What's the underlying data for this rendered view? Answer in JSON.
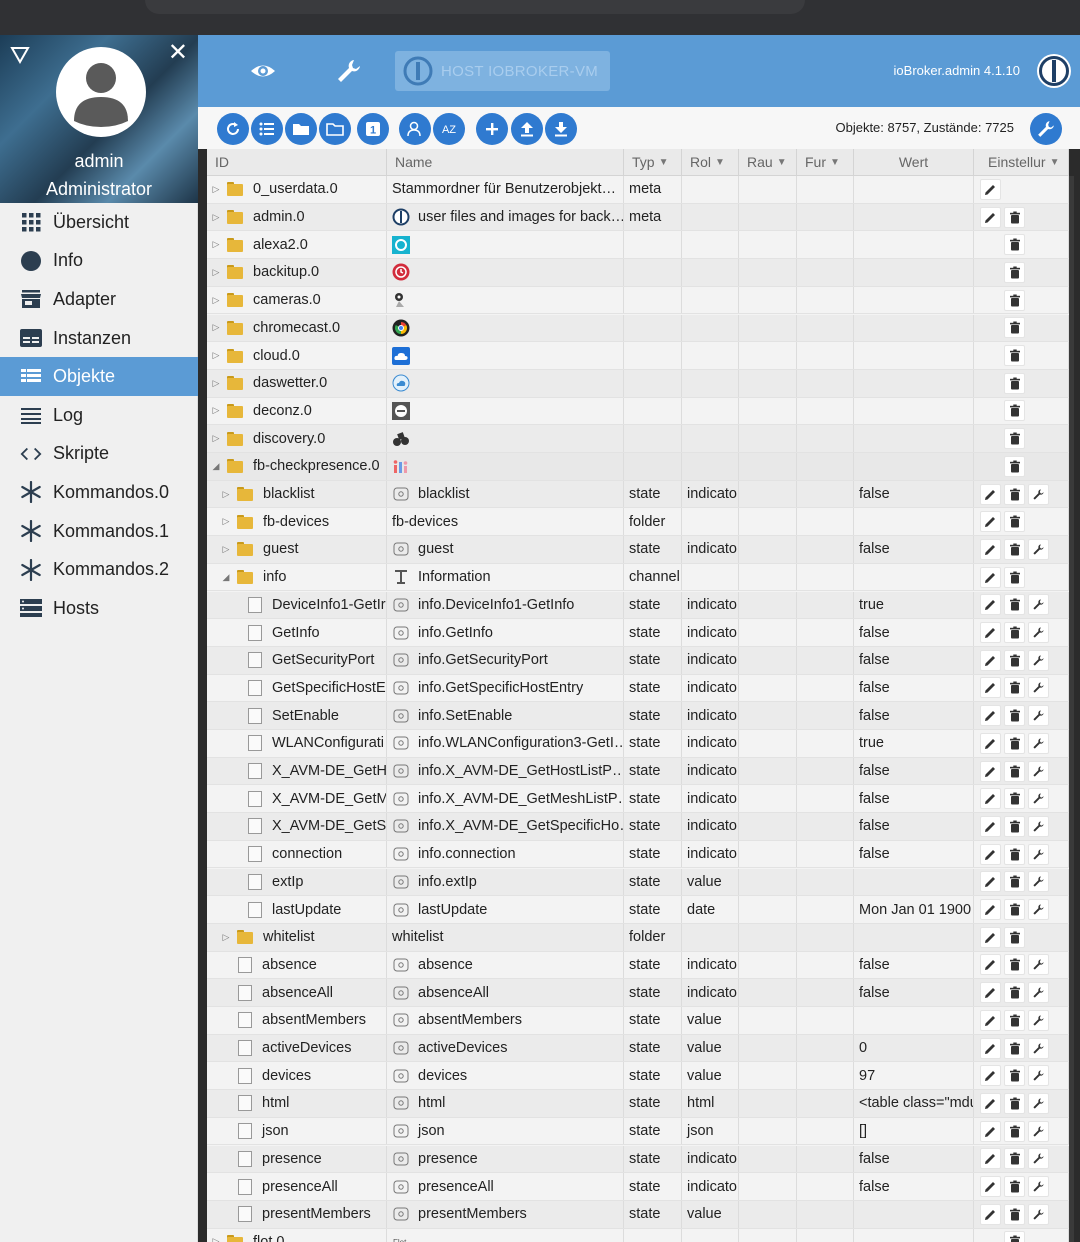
{
  "sidebar": {
    "user_name": "admin",
    "user_role": "Administrator",
    "items": [
      {
        "label": "Übersicht",
        "icon": "grid-icon",
        "active": false
      },
      {
        "label": "Info",
        "icon": "info-icon",
        "active": false
      },
      {
        "label": "Adapter",
        "icon": "store-icon",
        "active": false
      },
      {
        "label": "Instanzen",
        "icon": "instances-icon",
        "active": false
      },
      {
        "label": "Objekte",
        "icon": "list-icon",
        "active": true
      },
      {
        "label": "Log",
        "icon": "log-icon",
        "active": false
      },
      {
        "label": "Skripte",
        "icon": "code-icon",
        "active": false
      },
      {
        "label": "Kommandos.0",
        "icon": "asterisk-icon",
        "active": false
      },
      {
        "label": "Kommandos.1",
        "icon": "asterisk-icon",
        "active": false
      },
      {
        "label": "Kommandos.2",
        "icon": "asterisk-icon",
        "active": false
      },
      {
        "label": "Hosts",
        "icon": "hosts-icon",
        "active": false
      }
    ]
  },
  "topbar": {
    "host_label": "HOST IOBROKER-VM",
    "version": "ioBroker.admin 4.1.10"
  },
  "toolbar": {
    "object_count": "Objekte: 8757, Zustände: 7725"
  },
  "columns": {
    "id": "ID",
    "name": "Name",
    "type": "Typ",
    "role": "Rol",
    "room": "Rau",
    "function": "Fur",
    "value": "Wert",
    "settings": "Einstellur"
  },
  "colors": {
    "accent": "#5b9bd5",
    "button": "#2f7ad0"
  },
  "rows": [
    {
      "id": "0_userdata.0",
      "indent": 0,
      "kind": "folder",
      "tw": "closed",
      "name": "Stammordner für Benutzerobjekt…",
      "name_icon": "",
      "type": "meta",
      "role": "",
      "value": "",
      "actions": [
        "edit"
      ]
    },
    {
      "id": "admin.0",
      "indent": 0,
      "kind": "folder",
      "tw": "closed",
      "name": "user files and images for back…",
      "name_icon": "iobroker-logo-icon",
      "type": "meta",
      "role": "",
      "value": "",
      "actions": [
        "edit",
        "delete"
      ]
    },
    {
      "id": "alexa2.0",
      "indent": 0,
      "kind": "folder",
      "tw": "closed",
      "name": "",
      "name_icon": "alexa-icon",
      "type": "",
      "role": "",
      "value": "",
      "actions": [
        "delete"
      ]
    },
    {
      "id": "backitup.0",
      "indent": 0,
      "kind": "folder",
      "tw": "closed",
      "name": "",
      "name_icon": "backitup-icon",
      "type": "",
      "role": "",
      "value": "",
      "actions": [
        "delete"
      ]
    },
    {
      "id": "cameras.0",
      "indent": 0,
      "kind": "folder",
      "tw": "closed",
      "name": "",
      "name_icon": "camera-icon",
      "type": "",
      "role": "",
      "value": "",
      "actions": [
        "delete"
      ]
    },
    {
      "id": "chromecast.0",
      "indent": 0,
      "kind": "folder",
      "tw": "closed",
      "name": "",
      "name_icon": "chromecast-icon",
      "type": "",
      "role": "",
      "value": "",
      "actions": [
        "delete"
      ]
    },
    {
      "id": "cloud.0",
      "indent": 0,
      "kind": "folder",
      "tw": "closed",
      "name": "",
      "name_icon": "cloud-icon",
      "type": "",
      "role": "",
      "value": "",
      "actions": [
        "delete"
      ]
    },
    {
      "id": "daswetter.0",
      "indent": 0,
      "kind": "folder",
      "tw": "closed",
      "name": "",
      "name_icon": "weather-icon",
      "type": "",
      "role": "",
      "value": "",
      "actions": [
        "delete"
      ]
    },
    {
      "id": "deconz.0",
      "indent": 0,
      "kind": "folder",
      "tw": "closed",
      "name": "",
      "name_icon": "deconz-icon",
      "type": "",
      "role": "",
      "value": "",
      "actions": [
        "delete"
      ]
    },
    {
      "id": "discovery.0",
      "indent": 0,
      "kind": "folder",
      "tw": "closed",
      "name": "",
      "name_icon": "binoculars-icon",
      "type": "",
      "role": "",
      "value": "",
      "actions": [
        "delete"
      ]
    },
    {
      "id": "fb-checkpresence.0",
      "indent": 0,
      "kind": "folder",
      "tw": "open",
      "name": "",
      "name_icon": "checkpresence-icon",
      "type": "",
      "role": "",
      "value": "",
      "actions": [
        "delete"
      ]
    },
    {
      "id": "blacklist",
      "indent": 1,
      "kind": "folder",
      "tw": "closed",
      "name": "blacklist",
      "name_icon": "state-icon",
      "type": "state",
      "role": "indicato",
      "value": "false",
      "actions": [
        "edit",
        "delete",
        "wrench"
      ]
    },
    {
      "id": "fb-devices",
      "indent": 1,
      "kind": "folder",
      "tw": "closed",
      "name": "fb-devices",
      "name_icon": "",
      "type": "folder",
      "role": "",
      "value": "",
      "actions": [
        "edit",
        "delete"
      ]
    },
    {
      "id": "guest",
      "indent": 1,
      "kind": "folder",
      "tw": "closed",
      "name": "guest",
      "name_icon": "state-icon",
      "type": "state",
      "role": "indicato",
      "value": "false",
      "actions": [
        "edit",
        "delete",
        "wrench"
      ]
    },
    {
      "id": "info",
      "indent": 1,
      "kind": "folder",
      "tw": "open",
      "name": "Information",
      "name_icon": "channel-icon",
      "type": "channel",
      "role": "",
      "value": "",
      "actions": [
        "edit",
        "delete"
      ]
    },
    {
      "id": "DeviceInfo1-GetIr",
      "indent": 2,
      "kind": "file",
      "tw": "",
      "name": "info.DeviceInfo1-GetInfo",
      "name_icon": "state-icon",
      "type": "state",
      "role": "indicato",
      "value": "true",
      "actions": [
        "edit",
        "delete",
        "wrench"
      ]
    },
    {
      "id": "GetInfo",
      "indent": 2,
      "kind": "file",
      "tw": "",
      "name": "info.GetInfo",
      "name_icon": "state-icon",
      "type": "state",
      "role": "indicato",
      "value": "false",
      "actions": [
        "edit",
        "delete",
        "wrench"
      ]
    },
    {
      "id": "GetSecurityPort",
      "indent": 2,
      "kind": "file",
      "tw": "",
      "name": "info.GetSecurityPort",
      "name_icon": "state-icon",
      "type": "state",
      "role": "indicato",
      "value": "false",
      "actions": [
        "edit",
        "delete",
        "wrench"
      ]
    },
    {
      "id": "GetSpecificHostE",
      "indent": 2,
      "kind": "file",
      "tw": "",
      "name": "info.GetSpecificHostEntry",
      "name_icon": "state-icon",
      "type": "state",
      "role": "indicato",
      "value": "false",
      "actions": [
        "edit",
        "delete",
        "wrench"
      ]
    },
    {
      "id": "SetEnable",
      "indent": 2,
      "kind": "file",
      "tw": "",
      "name": "info.SetEnable",
      "name_icon": "state-icon",
      "type": "state",
      "role": "indicato",
      "value": "false",
      "actions": [
        "edit",
        "delete",
        "wrench"
      ]
    },
    {
      "id": "WLANConfigurati",
      "indent": 2,
      "kind": "file",
      "tw": "",
      "name": "info.WLANConfiguration3-GetI…",
      "name_icon": "state-icon",
      "type": "state",
      "role": "indicato",
      "value": "true",
      "actions": [
        "edit",
        "delete",
        "wrench"
      ]
    },
    {
      "id": "X_AVM-DE_GetHo",
      "indent": 2,
      "kind": "file",
      "tw": "",
      "name": "info.X_AVM-DE_GetHostListP…",
      "name_icon": "state-icon",
      "type": "state",
      "role": "indicato",
      "value": "false",
      "actions": [
        "edit",
        "delete",
        "wrench"
      ]
    },
    {
      "id": "X_AVM-DE_GetMe",
      "indent": 2,
      "kind": "file",
      "tw": "",
      "name": "info.X_AVM-DE_GetMeshListP…",
      "name_icon": "state-icon",
      "type": "state",
      "role": "indicato",
      "value": "false",
      "actions": [
        "edit",
        "delete",
        "wrench"
      ]
    },
    {
      "id": "X_AVM-DE_GetSp",
      "indent": 2,
      "kind": "file",
      "tw": "",
      "name": "info.X_AVM-DE_GetSpecificHo…",
      "name_icon": "state-icon",
      "type": "state",
      "role": "indicato",
      "value": "false",
      "actions": [
        "edit",
        "delete",
        "wrench"
      ]
    },
    {
      "id": "connection",
      "indent": 2,
      "kind": "file",
      "tw": "",
      "name": "info.connection",
      "name_icon": "state-icon",
      "type": "state",
      "role": "indicato",
      "value": "false",
      "actions": [
        "edit",
        "delete",
        "wrench"
      ]
    },
    {
      "id": "extIp",
      "indent": 2,
      "kind": "file",
      "tw": "",
      "name": "info.extIp",
      "name_icon": "state-icon",
      "type": "state",
      "role": "value",
      "value": "",
      "actions": [
        "edit",
        "delete",
        "wrench"
      ]
    },
    {
      "id": "lastUpdate",
      "indent": 2,
      "kind": "file",
      "tw": "",
      "name": "lastUpdate",
      "name_icon": "state-icon",
      "type": "state",
      "role": "date",
      "value": "Mon Jan 01 1900",
      "actions": [
        "edit",
        "delete",
        "wrench"
      ]
    },
    {
      "id": "whitelist",
      "indent": 1,
      "kind": "folder",
      "tw": "closed",
      "name": "whitelist",
      "name_icon": "",
      "type": "folder",
      "role": "",
      "value": "",
      "actions": [
        "edit",
        "delete"
      ]
    },
    {
      "id": "absence",
      "indent": 1,
      "kind": "file",
      "tw": "",
      "name": "absence",
      "name_icon": "state-icon",
      "type": "state",
      "role": "indicato",
      "value": "false",
      "actions": [
        "edit",
        "delete",
        "wrench"
      ]
    },
    {
      "id": "absenceAll",
      "indent": 1,
      "kind": "file",
      "tw": "",
      "name": "absenceAll",
      "name_icon": "state-icon",
      "type": "state",
      "role": "indicato",
      "value": "false",
      "actions": [
        "edit",
        "delete",
        "wrench"
      ]
    },
    {
      "id": "absentMembers",
      "indent": 1,
      "kind": "file",
      "tw": "",
      "name": "absentMembers",
      "name_icon": "state-icon",
      "type": "state",
      "role": "value",
      "value": "",
      "actions": [
        "edit",
        "delete",
        "wrench"
      ]
    },
    {
      "id": "activeDevices",
      "indent": 1,
      "kind": "file",
      "tw": "",
      "name": "activeDevices",
      "name_icon": "state-icon",
      "type": "state",
      "role": "value",
      "value": "0",
      "actions": [
        "edit",
        "delete",
        "wrench"
      ]
    },
    {
      "id": "devices",
      "indent": 1,
      "kind": "file",
      "tw": "",
      "name": "devices",
      "name_icon": "state-icon",
      "type": "state",
      "role": "value",
      "value": "97",
      "actions": [
        "edit",
        "delete",
        "wrench"
      ]
    },
    {
      "id": "html",
      "indent": 1,
      "kind": "file",
      "tw": "",
      "name": "html",
      "name_icon": "state-icon",
      "type": "state",
      "role": "html",
      "value": "<table class=\"mdu",
      "actions": [
        "edit",
        "delete",
        "wrench"
      ]
    },
    {
      "id": "json",
      "indent": 1,
      "kind": "file",
      "tw": "",
      "name": "json",
      "name_icon": "state-icon",
      "type": "state",
      "role": "json",
      "value": "[]",
      "actions": [
        "edit",
        "delete",
        "wrench"
      ]
    },
    {
      "id": "presence",
      "indent": 1,
      "kind": "file",
      "tw": "",
      "name": "presence",
      "name_icon": "state-icon",
      "type": "state",
      "role": "indicato",
      "value": "false",
      "actions": [
        "edit",
        "delete",
        "wrench"
      ]
    },
    {
      "id": "presenceAll",
      "indent": 1,
      "kind": "file",
      "tw": "",
      "name": "presenceAll",
      "name_icon": "state-icon",
      "type": "state",
      "role": "indicato",
      "value": "false",
      "actions": [
        "edit",
        "delete",
        "wrench"
      ]
    },
    {
      "id": "presentMembers",
      "indent": 1,
      "kind": "file",
      "tw": "",
      "name": "presentMembers",
      "name_icon": "state-icon",
      "type": "state",
      "role": "value",
      "value": "",
      "actions": [
        "edit",
        "delete",
        "wrench"
      ]
    },
    {
      "id": "flot.0",
      "indent": 0,
      "kind": "folder",
      "tw": "closed",
      "name": "",
      "name_icon": "flot-icon",
      "type": "",
      "role": "",
      "value": "",
      "actions": [
        "delete"
      ]
    }
  ]
}
